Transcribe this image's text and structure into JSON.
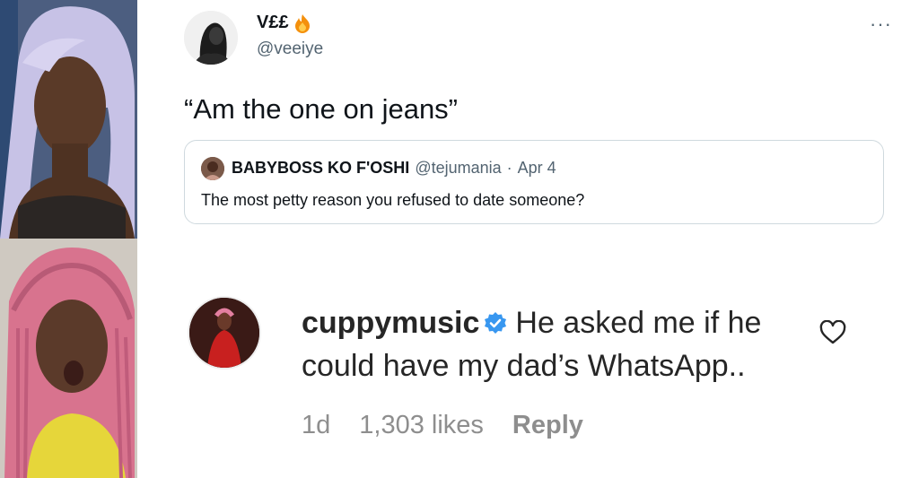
{
  "tweet": {
    "author_name": "V££",
    "author_badge_icon": "fire-icon",
    "author_handle": "@veeiye",
    "more_icon_text": "···",
    "text": "“Am the one on jeans”",
    "quoted": {
      "author_name": "BABYBOSS KO F'OSHI",
      "author_handle": "@tejumania",
      "separator": "·",
      "date": "Apr 4",
      "text": "The most petty reason you refused to date someone?"
    }
  },
  "comment": {
    "username": "cuppymusic",
    "verified_icon": "verified-badge-icon",
    "text": "He asked me if he could have my dad’s WhatsApp..",
    "time": "1d",
    "likes": "1,303 likes",
    "reply_label": "Reply",
    "like_icon": "heart-outline-icon"
  },
  "colors": {
    "secondary_text": "#536471",
    "quote_border": "#cfd9de",
    "instagram_meta": "#8e8e8e",
    "verified_blue": "#3897f0",
    "fire": "#f4900c"
  }
}
